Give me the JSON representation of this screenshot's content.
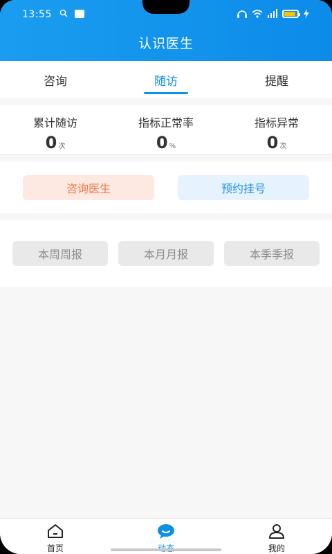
{
  "status_bar": {
    "time": "13:55"
  },
  "header": {
    "title": "认识医生"
  },
  "tabs": [
    {
      "label": "咨询",
      "active": false
    },
    {
      "label": "随访",
      "active": true
    },
    {
      "label": "提醒",
      "active": false
    }
  ],
  "stats": [
    {
      "label": "累计随访",
      "value": "0",
      "unit": "次"
    },
    {
      "label": "指标正常率",
      "value": "0",
      "unit": "%"
    },
    {
      "label": "指标异常",
      "value": "0",
      "unit": "次"
    }
  ],
  "actions": {
    "consult_label": "咨询医生",
    "register_label": "预约挂号"
  },
  "reports": [
    {
      "label": "本周周报"
    },
    {
      "label": "本月月报"
    },
    {
      "label": "本季季报"
    }
  ],
  "bottom_nav": [
    {
      "label": "首页",
      "icon": "home-icon",
      "active": false
    },
    {
      "label": "动态",
      "icon": "chat-bubble-icon",
      "active": true
    },
    {
      "label": "我的",
      "icon": "user-icon",
      "active": false
    }
  ],
  "colors": {
    "primary": "#0e8fe6",
    "consult_bg": "#fde9e1",
    "consult_text": "#f07a4a",
    "register_bg": "#e6f2fd"
  }
}
